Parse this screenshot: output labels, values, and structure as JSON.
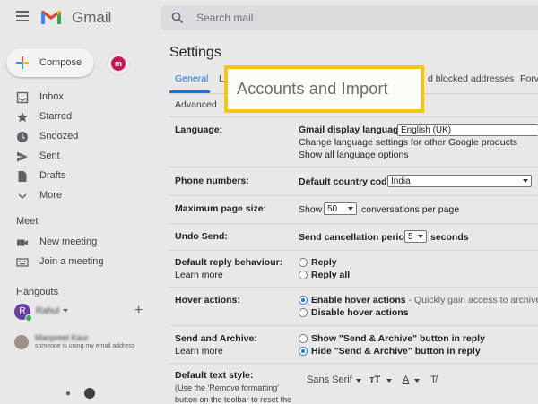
{
  "app": {
    "name": "Gmail",
    "search_placeholder": "Search mail"
  },
  "sidebar": {
    "compose_label": "Compose",
    "account_avatar_letter": "m",
    "items": [
      {
        "label": "Inbox",
        "icon": "inbox-icon"
      },
      {
        "label": "Starred",
        "icon": "star-icon"
      },
      {
        "label": "Snoozed",
        "icon": "clock-icon"
      },
      {
        "label": "Sent",
        "icon": "send-icon"
      },
      {
        "label": "Drafts",
        "icon": "draft-icon"
      },
      {
        "label": "More",
        "icon": "chevron-down-icon"
      }
    ],
    "meet": {
      "heading": "Meet",
      "items": [
        {
          "label": "New meeting",
          "icon": "video-icon"
        },
        {
          "label": "Join a meeting",
          "icon": "keyboard-icon"
        }
      ]
    },
    "hangouts": {
      "heading": "Hangouts",
      "user_initial": "R",
      "user_name": "Rahul",
      "contact_name": "Manpreet Kaur",
      "contact_status": "someone is using my email address"
    }
  },
  "settings": {
    "title": "Settings",
    "tabs": [
      "General",
      "L",
      "d blocked addresses",
      "Forv"
    ],
    "second_row_tab": "Advanced",
    "callout_text": "Accounts and Import",
    "rows": {
      "language": {
        "label": "Language:",
        "display_label": "Gmail display language:",
        "display_value": "English (UK)",
        "link1": "Change language settings for other Google products",
        "link2": "Show all language options"
      },
      "phone": {
        "label": "Phone numbers:",
        "field_label": "Default country code:",
        "value": "India"
      },
      "page_size": {
        "label": "Maximum page size:",
        "prefix": "Show",
        "value": "50",
        "suffix": "conversations per page"
      },
      "undo": {
        "label": "Undo Send:",
        "field_label": "Send cancellation period:",
        "value": "5",
        "suffix": "seconds"
      },
      "reply": {
        "label": "Default reply behaviour:",
        "learn_more": "Learn more",
        "options": [
          "Reply",
          "Reply all"
        ],
        "selected": -1
      },
      "hover": {
        "label": "Hover actions:",
        "option1_bold": "Enable hover actions",
        "option1_desc": " - Quickly gain access to archive, del",
        "option2": "Disable hover actions",
        "selected": 0
      },
      "send_archive": {
        "label": "Send and Archive:",
        "learn_more": "Learn more",
        "option1": "Show \"Send & Archive\" button in reply",
        "option2": "Hide \"Send & Archive\" button in reply",
        "selected": 1
      },
      "text_style": {
        "label": "Default text style:",
        "note_line1": "(Use the 'Remove formatting'",
        "note_line2": "button on the toolbar to reset the",
        "font": "Sans Serif"
      }
    }
  },
  "colors": {
    "accent": "#1a73e8",
    "callout_border": "#f5c518",
    "link": "#1a5fc4"
  }
}
